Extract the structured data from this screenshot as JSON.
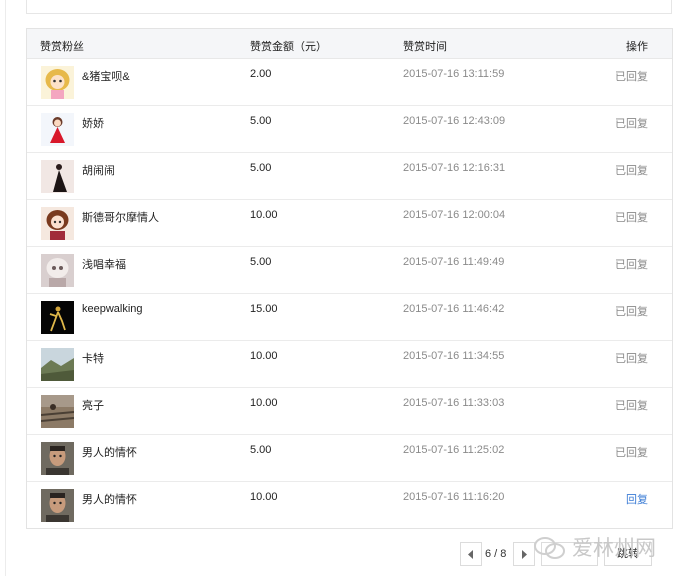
{
  "table": {
    "headers": {
      "fan": "赞赏粉丝",
      "amount": "赞赏金额（元）",
      "time": "赞赏时间",
      "action": "操作"
    },
    "rows": [
      {
        "name": "&猪宝呗&",
        "amount": "2.00",
        "time": "2015-07-16 13:11:59",
        "action": "已回复",
        "avatar": "cartoon-girl-avatar"
      },
      {
        "name": "娇娇",
        "amount": "5.00",
        "time": "2015-07-16 12:43:09",
        "action": "已回复",
        "avatar": "red-dress-girl-avatar"
      },
      {
        "name": "胡闹闹",
        "amount": "5.00",
        "time": "2015-07-16 12:16:31",
        "action": "已回复",
        "avatar": "black-dress-avatar"
      },
      {
        "name": "斯德哥尔摩情人",
        "amount": "10.00",
        "time": "2015-07-16 12:00:04",
        "action": "已回复",
        "avatar": "anime-girl-avatar"
      },
      {
        "name": "浅唱幸福",
        "amount": "5.00",
        "time": "2015-07-16 11:49:49",
        "action": "已回复",
        "avatar": "doll-avatar"
      },
      {
        "name": "keepwalking",
        "amount": "15.00",
        "time": "2015-07-16 11:46:42",
        "action": "已回复",
        "avatar": "dark-dancer-avatar"
      },
      {
        "name": "卡特",
        "amount": "10.00",
        "time": "2015-07-16 11:34:55",
        "action": "已回复",
        "avatar": "landscape-avatar"
      },
      {
        "name": "亮子",
        "amount": "10.00",
        "time": "2015-07-16 11:33:03",
        "action": "已回复",
        "avatar": "railway-avatar"
      },
      {
        "name": "男人的情怀",
        "amount": "5.00",
        "time": "2015-07-16 11:25:02",
        "action": "已回复",
        "avatar": "man-portrait-avatar"
      },
      {
        "name": "男人的情怀",
        "amount": "10.00",
        "time": "2015-07-16 11:16:20",
        "action": "回复",
        "avatar": "man-portrait-avatar"
      }
    ]
  },
  "pager": {
    "info": "6 / 8",
    "jump_label": "跳转",
    "jump_value": ""
  },
  "watermark": {
    "text": "爱林州网"
  },
  "colors": {
    "link": "#3a7bd5",
    "muted": "#8a8a8a",
    "header_bg": "#f5f6f8"
  }
}
